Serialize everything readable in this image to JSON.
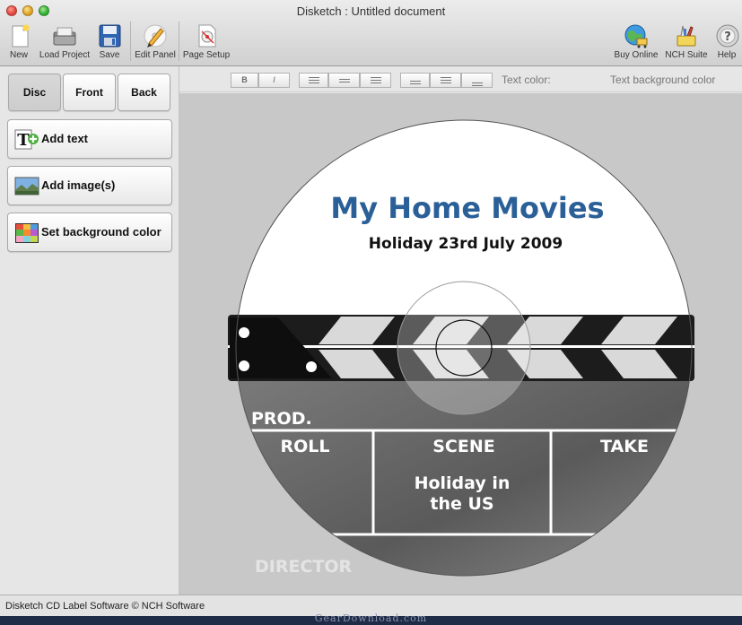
{
  "window": {
    "title": "Disketch : Untitled document"
  },
  "toolbar": {
    "items": [
      {
        "label": "New",
        "icon": "new-document-icon"
      },
      {
        "label": "Load Project",
        "icon": "folder-icon"
      },
      {
        "label": "Save",
        "icon": "floppy-disk-icon"
      },
      {
        "label": "Edit Panel",
        "icon": "edit-pencil-icon"
      },
      {
        "label": "Page Setup",
        "icon": "page-setup-icon"
      },
      {
        "label": "Buy Online",
        "icon": "globe-cart-icon"
      },
      {
        "label": "NCH Suite",
        "icon": "suite-tools-icon"
      },
      {
        "label": "Help",
        "icon": "help-icon"
      }
    ]
  },
  "format_bar": {
    "bold": "B",
    "italic": "I",
    "text_color_label": "Text color:",
    "text_bg_color_label": "Text background color",
    "text_color_value": "#e6ecf8"
  },
  "left_panel": {
    "tabs": [
      {
        "label": "Disc",
        "active": true
      },
      {
        "label": "Front",
        "active": false
      },
      {
        "label": "Back",
        "active": false
      }
    ],
    "actions": [
      {
        "label": "Add text",
        "icon": "add-text-icon"
      },
      {
        "label": "Add image(s)",
        "icon": "landscape-image-icon"
      },
      {
        "label": "Set background color",
        "icon": "color-palette-icon"
      }
    ]
  },
  "disc": {
    "title": "My Home Movies",
    "subtitle": "Holiday 23rd July 2009",
    "title_color": "#2a5f97",
    "clapboard": {
      "prod_label": "PROD.",
      "roll_label": "ROLL",
      "scene_label": "SCENE",
      "take_label": "TAKE",
      "scene_value_line1": "Holiday in",
      "scene_value_line2": "the US",
      "director_label": "DIRECTOR"
    }
  },
  "status": {
    "text": "Disketch CD Label Software © NCH Software"
  },
  "watermark": "GearDownload.com"
}
